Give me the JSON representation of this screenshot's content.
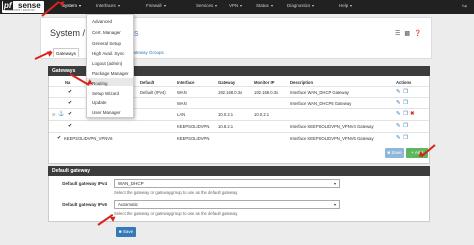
{
  "brand": {
    "logo_main": "pf",
    "logo_sub": "sense",
    "edition": "COMMUNITY EDITION"
  },
  "navbar": {
    "items": [
      {
        "label": "System",
        "active": true
      },
      {
        "label": "Interfaces"
      },
      {
        "label": "Firewall"
      },
      {
        "label": "Services"
      },
      {
        "label": "VPN"
      },
      {
        "label": "Status"
      },
      {
        "label": "Diagnostics"
      },
      {
        "label": "Help"
      }
    ],
    "exit_icon": "logout-icon"
  },
  "system_menu": {
    "items": [
      "Advanced",
      "Cert. Manager",
      "General Setup",
      "High Avail. Sync",
      "Logout (admin)",
      "Package Manager",
      "Routing",
      "Setup Wizard",
      "Update",
      "User Manager"
    ],
    "highlighted": "Routing"
  },
  "header": {
    "title_prefix": "System /",
    "title_suffix": "ways",
    "icons": [
      "sliders-icon",
      "chart-icon",
      "help-icon"
    ]
  },
  "tabs": [
    {
      "label": "Gateways",
      "active": true
    },
    {
      "label": "Gateway Groups"
    }
  ],
  "gateways": {
    "title": "Gateways",
    "columns": [
      "Na",
      "Default",
      "Interface",
      "Gateway",
      "Monitor IP",
      "Description",
      "Actions"
    ],
    "rows": [
      {
        "default": "Default (IPv4)",
        "interface": "WAN",
        "gateway": "192.168.0.3x",
        "monitor": "192.168.0.3x",
        "description": "Interface WAN_DHCP Gateway"
      },
      {
        "default": "",
        "interface": "WAN",
        "gateway": "",
        "monitor": "",
        "description": "Interface WAN_DHCP6 Gateway"
      },
      {
        "default": "",
        "interface": "LAN",
        "gateway": "10.0.2.1",
        "monitor": "10.0.2.1",
        "description": ""
      },
      {
        "default": "",
        "interface": "KEEPSOLIDVPN",
        "gateway": "10.8.2.1",
        "monitor": "",
        "description": "Interface KEEPSOLIDVPN_VPNV4 Gateway"
      },
      {
        "name": "KEEPSOLIDVPN_VPNV6",
        "default": "",
        "interface": "KEEPSOLIDVPN",
        "gateway": "",
        "monitor": "",
        "description": "Interface KEEPSOLIDVPN_VPNV6 Gateway"
      }
    ],
    "save_label": "Save",
    "add_label": "Add"
  },
  "default_gateway": {
    "title": "Default gateway",
    "ipv4_label": "Default gateway IPv4",
    "ipv4_value": "WAN_DHCP",
    "ipv4_help": "Select the gateway or gatewaygroup to use as the default gateway.",
    "ipv6_label": "Default gateway IPv6",
    "ipv6_value": "Automatic",
    "ipv6_help": "Select the gateway or gatewaygroup to use as the default gateway.",
    "save_label": "Save"
  },
  "colors": {
    "navbar": "#212121",
    "panel_head": "#3c3c3c",
    "link": "#337ab7",
    "add": "#5cb85c",
    "arrow": "#d9241c"
  }
}
